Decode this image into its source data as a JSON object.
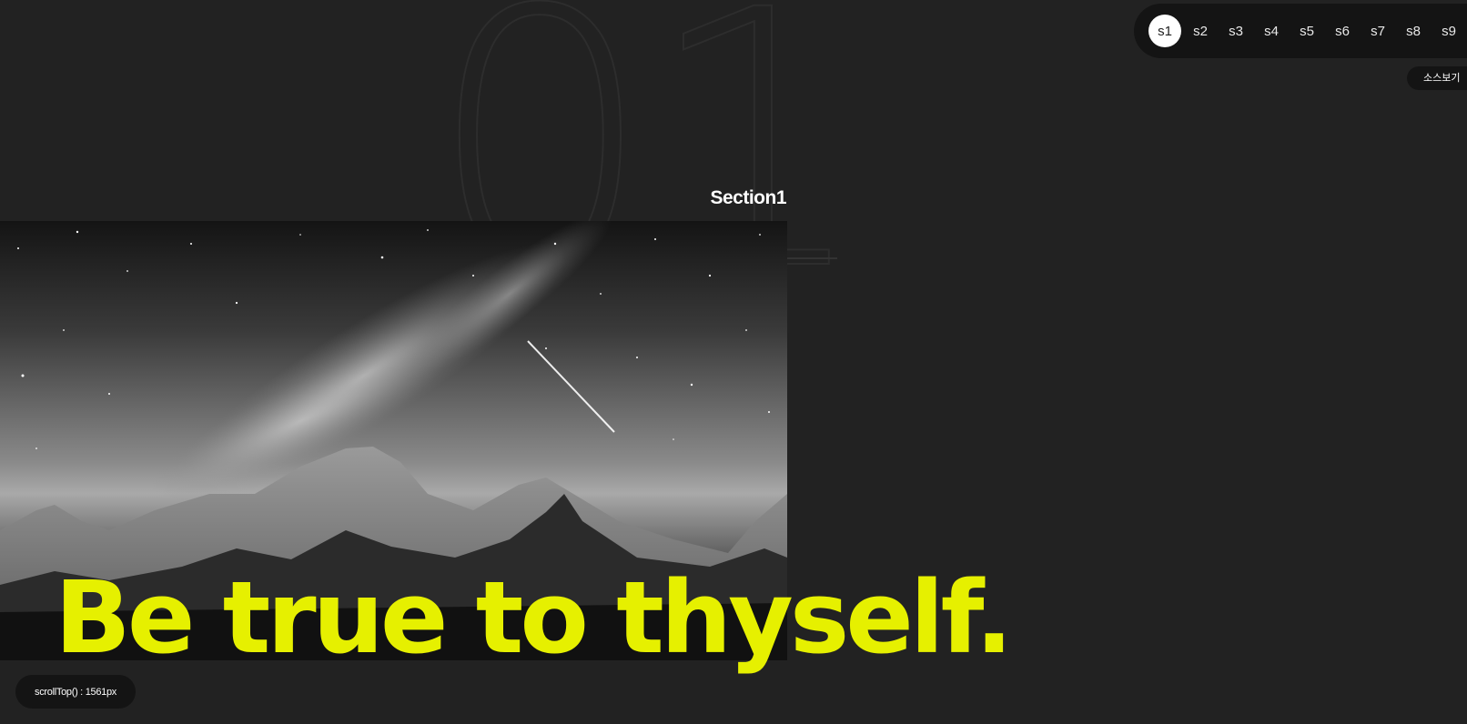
{
  "background": {
    "number": "01"
  },
  "section": {
    "title": "Section1"
  },
  "hero": {
    "headline": "Be true to thyself.",
    "headline_color": "#e6f000",
    "image_description_icon": "mountain-night-sky-image"
  },
  "nav": {
    "active": "s1",
    "items": [
      {
        "label": "s1"
      },
      {
        "label": "s2"
      },
      {
        "label": "s3"
      },
      {
        "label": "s4"
      },
      {
        "label": "s5"
      },
      {
        "label": "s6"
      },
      {
        "label": "s7"
      },
      {
        "label": "s8"
      },
      {
        "label": "s9"
      }
    ]
  },
  "source_button": {
    "label": "소스보기"
  },
  "scroll_info": {
    "text": "scrollTop() : 1561px"
  },
  "colors": {
    "page_bg": "#222222",
    "accent": "#e6f000",
    "pill_bg": "#141414"
  }
}
